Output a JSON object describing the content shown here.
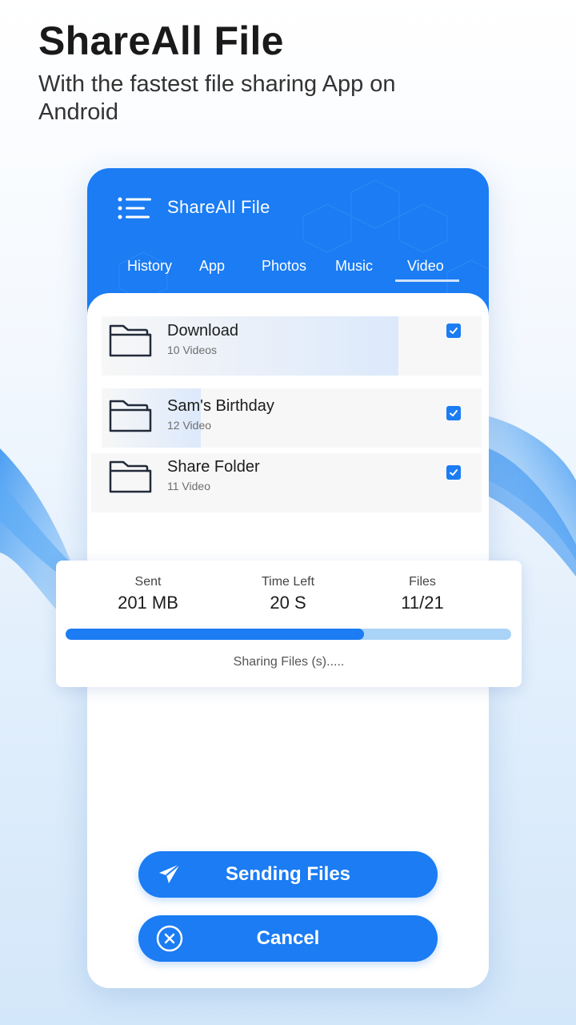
{
  "promo": {
    "title": "ShareAll File",
    "subtitle": "With the fastest file sharing App on Android"
  },
  "app": {
    "title": "ShareAll File",
    "menu_icon": "menu-icon",
    "tabs": [
      {
        "label": "History"
      },
      {
        "label": "App"
      },
      {
        "label": "Photos"
      },
      {
        "label": "Music"
      },
      {
        "label": "Video",
        "active": true
      }
    ]
  },
  "folders": [
    {
      "name": "Download",
      "count": "10 Videos",
      "checked": true,
      "icon": "folder-icon",
      "progress": 0.78
    },
    {
      "name": "Sam's Birthday",
      "count": "12 Video",
      "checked": true,
      "icon": "folder-icon",
      "progress": 0.26
    },
    {
      "name": "Share Folder",
      "count": "11 Video",
      "checked": true,
      "icon": "folder-icon",
      "progress": 0
    }
  ],
  "transfer": {
    "sent_label": "Sent",
    "sent_value": "201 MB",
    "time_label": "Time Left",
    "time_value": "20 S",
    "files_label": "Files",
    "files_value": "11/21",
    "progress": 0.67,
    "status": "Sharing Files (s)....."
  },
  "buttons": {
    "send_label": "Sending Files",
    "send_icon": "paper-plane-icon",
    "cancel_label": "Cancel",
    "cancel_icon": "close-circle-icon"
  },
  "colors": {
    "accent": "#1b7cf3",
    "progress_track": "#a9d3f7"
  }
}
